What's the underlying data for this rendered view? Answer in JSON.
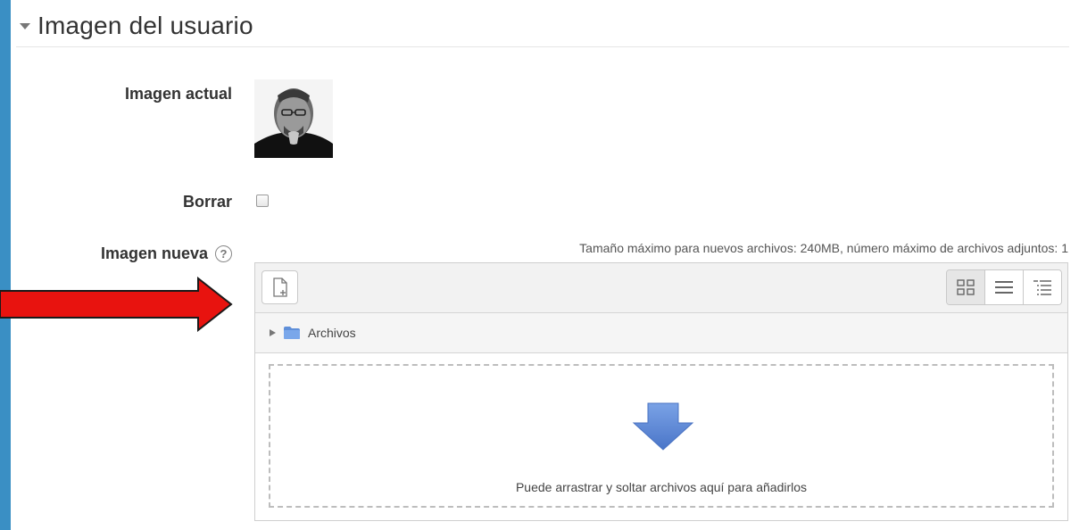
{
  "section": {
    "title": "Imagen del usuario"
  },
  "fields": {
    "current_image_label": "Imagen actual",
    "delete_label": "Borrar",
    "new_image_label": "Imagen nueva",
    "help_icon": "help-icon"
  },
  "filemanager": {
    "max_info": "Tamaño máximo para nuevos archivos: 240MB, número máximo de archivos adjuntos: 1",
    "path_folder": "Archivos",
    "drop_text": "Puede arrastrar y soltar archivos aquí para añadirlos",
    "icons": [
      "add-file-icon",
      "grid-view-icon",
      "list-view-icon",
      "tree-view-icon",
      "folder-icon",
      "down-arrow-icon"
    ]
  },
  "colors": {
    "background": "#3a8fc4",
    "annotation_arrow": "#e8130f",
    "drop_arrow": "#5b86d6"
  }
}
